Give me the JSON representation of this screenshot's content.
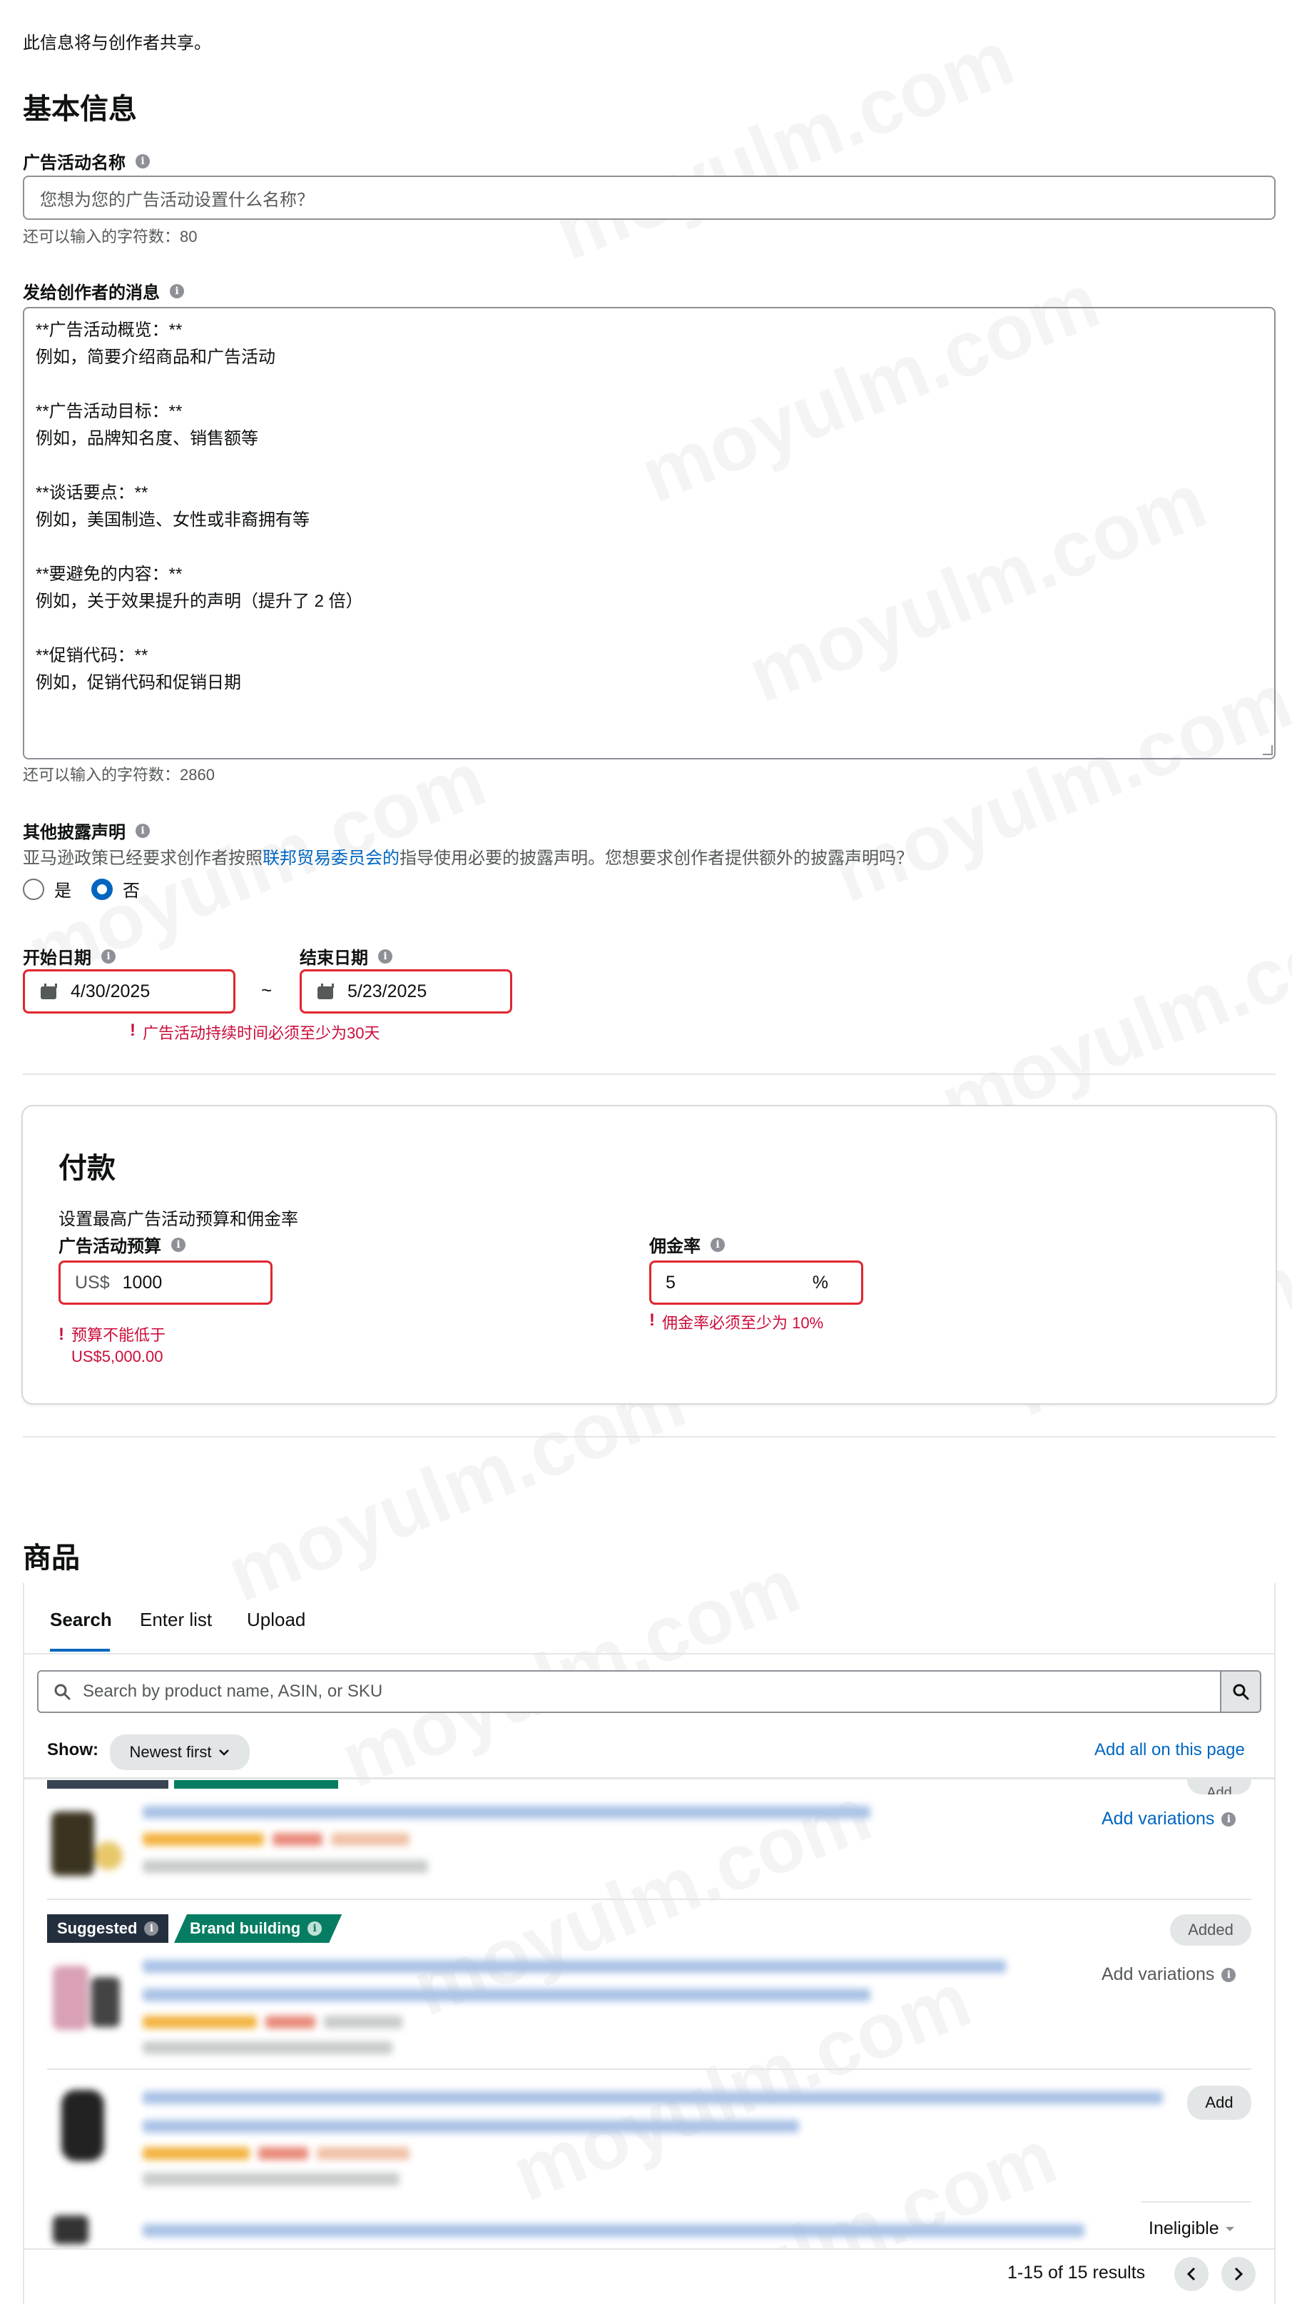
{
  "intro_text": "此信息将与创作者共享。",
  "basic": {
    "heading": "基本信息",
    "campaign_name_label": "广告活动名称",
    "campaign_name_placeholder": "您想为您的广告活动设置什么名称？",
    "campaign_name_remaining": "还可以输入的字符数：80",
    "message_label": "发给创作者的消息",
    "message_text": "**广告活动概览：**\n例如，简要介绍商品和广告活动\n\n**广告活动目标：**\n例如，品牌知名度、销售额等\n\n**谈话要点：**\n例如，美国制造、女性或非裔拥有等\n\n**要避免的内容：**\n例如，关于效果提升的声明（提升了 2 倍）\n\n**促销代码：**\n例如，促销代码和促销日期",
    "message_remaining": "还可以输入的字符数：2860",
    "disclosure_label": "其他披露声明",
    "disclosure_text_pre": "亚马逊政策已经要求创作者按照",
    "disclosure_link": "联邦贸易委员会的",
    "disclosure_text_post": "指导使用必要的披露声明。您想要求创作者提供额外的披露声明吗？",
    "radio_yes": "是",
    "radio_no": "否",
    "start_date_label": "开始日期",
    "start_date_value": "4/30/2025",
    "end_date_label": "结束日期",
    "end_date_value": "5/23/2025",
    "date_separator": "~",
    "date_error": "广告活动持续时间必须至少为30天"
  },
  "payment": {
    "heading": "付款",
    "subtitle": "设置最高广告活动预算和佣金率",
    "budget_label": "广告活动预算",
    "budget_prefix": "US$",
    "budget_value": "1000",
    "budget_error_line1": "预算不能低于",
    "budget_error_line2": "US$5,000.00",
    "commission_label": "佣金率",
    "commission_value": "5",
    "commission_suffix": "%",
    "commission_error": "佣金率必须至少为 10%"
  },
  "products": {
    "heading": "商品",
    "tabs": [
      "Search",
      "Enter list",
      "Upload"
    ],
    "search_placeholder": "Search by product name, ASIN, or SKU",
    "show_label": "Show:",
    "sort_value": "Newest first",
    "add_all_link": "Add all on this page",
    "items": [
      {
        "action": "Add variations",
        "action_state": "link",
        "button": "Add"
      },
      {
        "badge_suggested": "Suggested",
        "badge_brand": "Brand building",
        "button": "Added",
        "action": "Add variations",
        "action_state": "disabled"
      },
      {
        "button": "Add"
      },
      {
        "status": "Ineligible"
      }
    ],
    "pagination": "1-15 of 15 results"
  },
  "watermark": "moyulm.com",
  "colors": {
    "error": "#cc0c39",
    "link": "#0066c0",
    "badge_dark": "#232f3e",
    "badge_green": "#067d62"
  }
}
